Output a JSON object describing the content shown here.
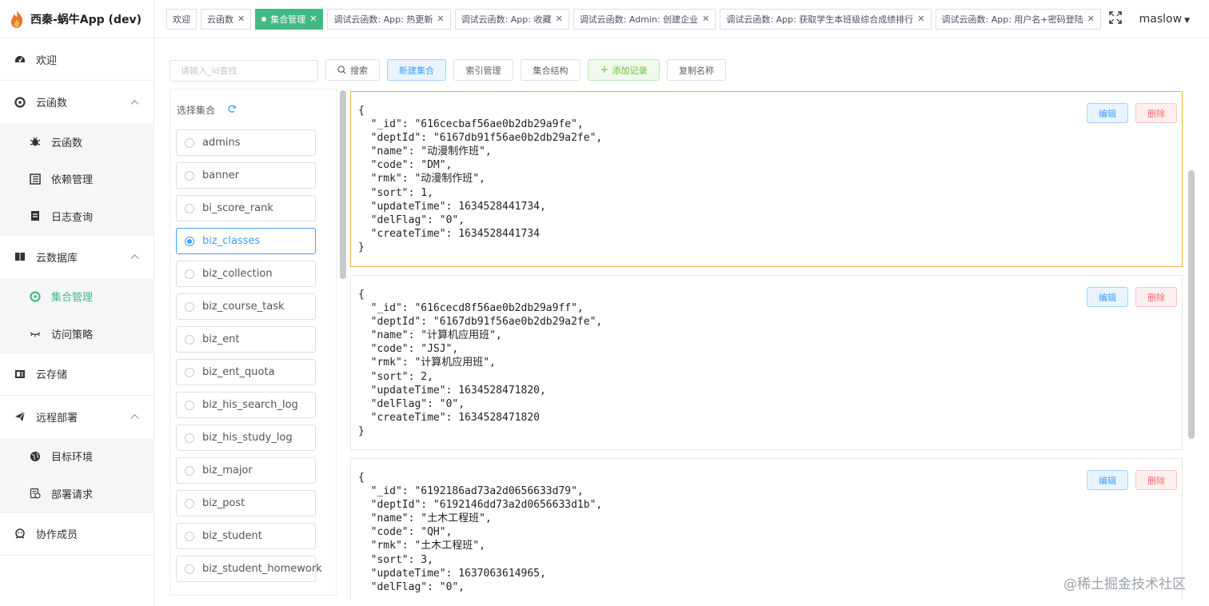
{
  "app": {
    "title": "西秦-蜗牛App (dev)"
  },
  "sidebar": {
    "items": [
      {
        "label": "欢迎",
        "icon": "dashboard-icon"
      },
      {
        "label": "云函数",
        "icon": "cloud-function-icon",
        "children": [
          {
            "label": "云函数",
            "icon": "bug-icon"
          },
          {
            "label": "依赖管理",
            "icon": "list-icon"
          },
          {
            "label": "日志查询",
            "icon": "document-icon"
          }
        ]
      },
      {
        "label": "云数据库",
        "icon": "database-icon",
        "children": [
          {
            "label": "集合管理",
            "icon": "collection-icon"
          },
          {
            "label": "访问策略",
            "icon": "eye-icon"
          }
        ]
      },
      {
        "label": "云存储",
        "icon": "storage-icon"
      },
      {
        "label": "远程部署",
        "icon": "send-icon",
        "children": [
          {
            "label": "目标环境",
            "icon": "globe-icon"
          },
          {
            "label": "部署请求",
            "icon": "request-icon"
          }
        ]
      },
      {
        "label": "协作成员",
        "icon": "team-icon"
      }
    ]
  },
  "tabs": [
    {
      "label": "欢迎"
    },
    {
      "label": "云函数"
    },
    {
      "label": "集合管理"
    },
    {
      "label": "调试云函数: App: 热更新"
    },
    {
      "label": "调试云函数: App: 收藏"
    },
    {
      "label": "调试云函数: Admin: 创建企业"
    },
    {
      "label": "调试云函数: App: 获取学生本班级综合成绩排行"
    },
    {
      "label": "调试云函数: App: 用户名+密码登陆"
    }
  ],
  "user": {
    "name": "maslow"
  },
  "toolbar": {
    "search_placeholder": "请输入_id查找",
    "search_label": "搜索",
    "new_collection_label": "新建集合",
    "index_label": "索引管理",
    "structure_label": "集合结构",
    "add_record_label": "添加记录",
    "copy_name_label": "复制名称"
  },
  "collections": {
    "header": "选择集合",
    "selected": "biz_classes",
    "items": [
      "admins",
      "banner",
      "bi_score_rank",
      "biz_classes",
      "biz_collection",
      "biz_course_task",
      "biz_ent",
      "biz_ent_quota",
      "biz_his_search_log",
      "biz_his_study_log",
      "biz_major",
      "biz_post",
      "biz_student",
      "biz_student_homework"
    ]
  },
  "records": {
    "edit_label": "编辑",
    "delete_label": "删除",
    "items": [
      "{\n  \"_id\": \"616cecbaf56ae0b2db29a9fe\",\n  \"deptId\": \"6167db91f56ae0b2db29a2fe\",\n  \"name\": \"动漫制作班\",\n  \"code\": \"DM\",\n  \"rmk\": \"动漫制作班\",\n  \"sort\": 1,\n  \"updateTime\": 1634528441734,\n  \"delFlag\": \"0\",\n  \"createTime\": 1634528441734\n}",
      "{\n  \"_id\": \"616cecd8f56ae0b2db29a9ff\",\n  \"deptId\": \"6167db91f56ae0b2db29a2fe\",\n  \"name\": \"计算机应用班\",\n  \"code\": \"JSJ\",\n  \"rmk\": \"计算机应用班\",\n  \"sort\": 2,\n  \"updateTime\": 1634528471820,\n  \"delFlag\": \"0\",\n  \"createTime\": 1634528471820\n}",
      "{\n  \"_id\": \"6192186ad73a2d0656633d79\",\n  \"deptId\": \"6192146dd73a2d0656633d1b\",\n  \"name\": \"土木工程班\",\n  \"code\": \"QH\",\n  \"rmk\": \"土木工程班\",\n  \"sort\": 3,\n  \"updateTime\": 1637063614965,\n  \"delFlag\": \"0\","
    ]
  },
  "watermark": "@稀土掘金技术社区",
  "colors": {
    "accent": "#42b983",
    "primary": "#409eff",
    "danger": "#f56c6c",
    "highlight": "#e6b43c"
  }
}
